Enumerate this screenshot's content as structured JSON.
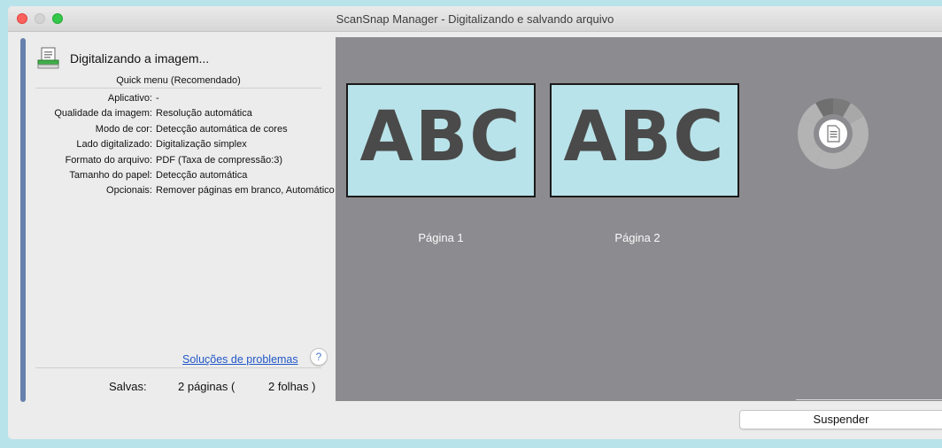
{
  "window": {
    "title": "ScanSnap Manager - Digitalizando e salvando arquivo"
  },
  "status": {
    "text": "Digitalizando a imagem...",
    "icon": "scanner-document-icon"
  },
  "quick_menu": "Quick menu (Recomendado)",
  "settings": [
    {
      "label": "Aplicativo:",
      "value": "-"
    },
    {
      "label": "Qualidade da imagem:",
      "value": "Resolução automática"
    },
    {
      "label": "Modo de cor:",
      "value": "Detecção automática de cores"
    },
    {
      "label": "Lado digitalizado:",
      "value": "Digitalização simplex"
    },
    {
      "label": "Formato do arquivo:",
      "value": "PDF (Taxa de compressão:3)"
    },
    {
      "label": "Tamanho do papel:",
      "value": "Detecção automática"
    },
    {
      "label": "Opcionais:",
      "value": "Remover páginas em branco, Automático"
    }
  ],
  "help": {
    "link": "Soluções de problemas",
    "button": "?"
  },
  "saved": {
    "label": "Salvas:",
    "pages": "2 páginas (",
    "sheets": "2 folhas )"
  },
  "preview": {
    "pages": [
      {
        "text": "ABC",
        "label": "Página 1"
      },
      {
        "text": "ABC",
        "label": "Página 2"
      }
    ],
    "spinner_icon": "document-loading-icon"
  },
  "buttons": {
    "suspend": "Suspender"
  },
  "colors": {
    "accent_bar": "#6781ad",
    "preview_bg": "#8c8b8f",
    "page_bg": "#b9e3ea",
    "link": "#2157c7"
  }
}
